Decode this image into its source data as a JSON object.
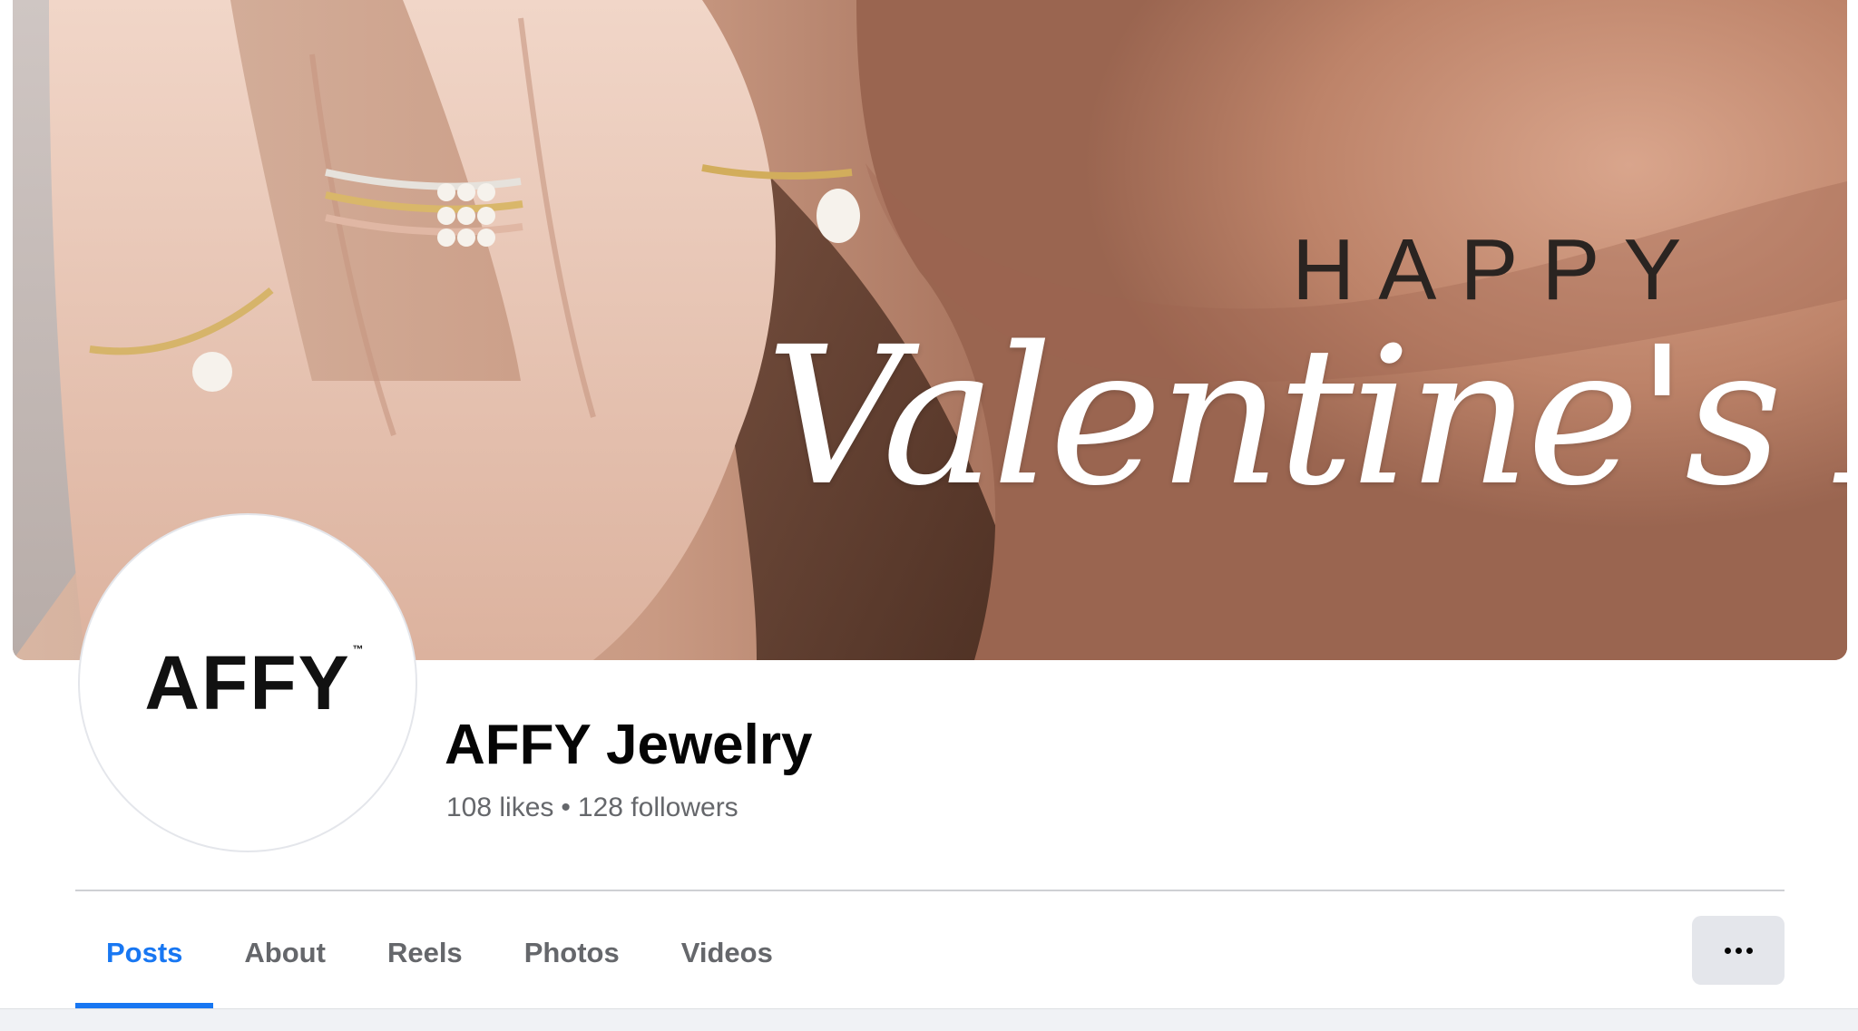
{
  "cover": {
    "headline_top": "HAPPY",
    "headline_script": "Valentine's Day"
  },
  "profile": {
    "logo_text": "AFFY",
    "logo_mark": "™",
    "name": "AFFY Jewelry",
    "likes": "108 likes",
    "separator": "•",
    "followers": "128 followers"
  },
  "tabs": [
    {
      "label": "Posts",
      "active": true
    },
    {
      "label": "About",
      "active": false
    },
    {
      "label": "Reels",
      "active": false
    },
    {
      "label": "Photos",
      "active": false
    },
    {
      "label": "Videos",
      "active": false
    }
  ],
  "more_button": {
    "icon": "more-horizontal-icon"
  },
  "colors": {
    "accent": "#1877f2",
    "text_primary": "#050505",
    "text_secondary": "#65676b",
    "button_bg": "#e4e6eb"
  }
}
